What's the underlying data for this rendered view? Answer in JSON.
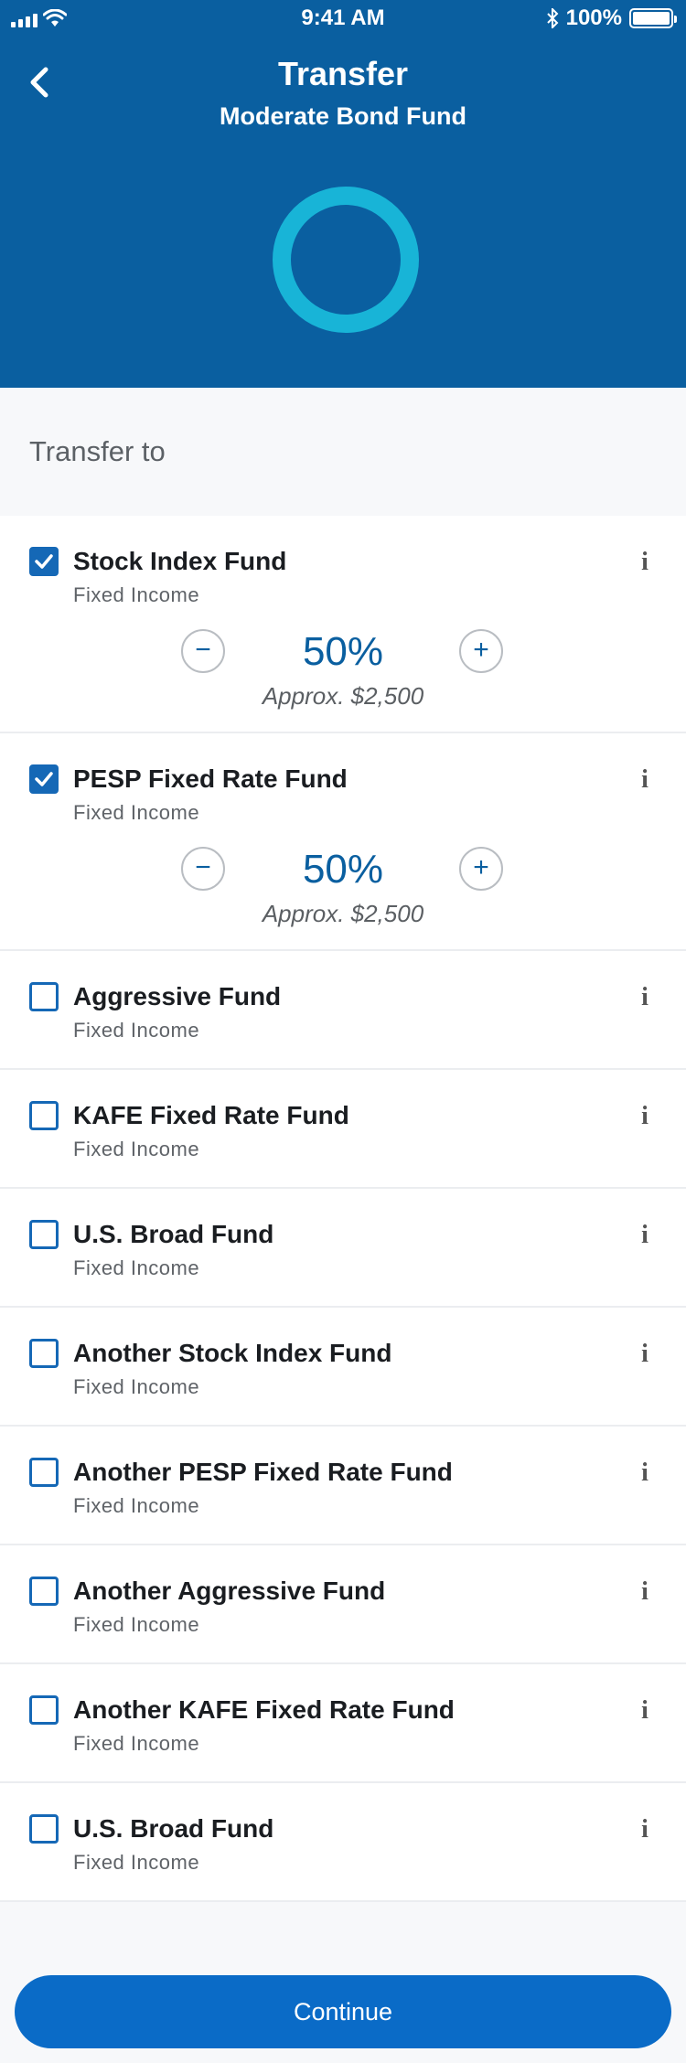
{
  "status_bar": {
    "time": "9:41 AM",
    "battery": "100%"
  },
  "header": {
    "title": "Transfer",
    "subtitle": "Moderate Bond Fund",
    "ring_color": "#18b4d7",
    "background": "#0a5fa0"
  },
  "section": {
    "label": "Transfer to"
  },
  "funds": [
    {
      "name": "Stock Index Fund",
      "category": "Fixed Income",
      "checked": true,
      "percent": "50%",
      "approx": "Approx. $2,500"
    },
    {
      "name": "PESP Fixed Rate Fund",
      "category": "Fixed Income",
      "checked": true,
      "percent": "50%",
      "approx": "Approx. $2,500"
    },
    {
      "name": "Aggressive Fund",
      "category": "Fixed Income",
      "checked": false
    },
    {
      "name": "KAFE Fixed Rate Fund",
      "category": "Fixed Income",
      "checked": false
    },
    {
      "name": "U.S. Broad Fund",
      "category": "Fixed Income",
      "checked": false
    },
    {
      "name": "Another Stock Index Fund",
      "category": "Fixed Income",
      "checked": false
    },
    {
      "name": "Another PESP Fixed Rate Fund",
      "category": "Fixed Income",
      "checked": false
    },
    {
      "name": "Another Aggressive Fund",
      "category": "Fixed Income",
      "checked": false
    },
    {
      "name": "Another KAFE Fixed Rate Fund",
      "category": "Fixed Income",
      "checked": false
    },
    {
      "name": "U.S. Broad Fund",
      "category": "Fixed Income",
      "checked": false
    }
  ],
  "stepper": {
    "minus": "−",
    "plus": "+"
  },
  "info_glyph": "i",
  "footer": {
    "continue_label": "Continue"
  }
}
